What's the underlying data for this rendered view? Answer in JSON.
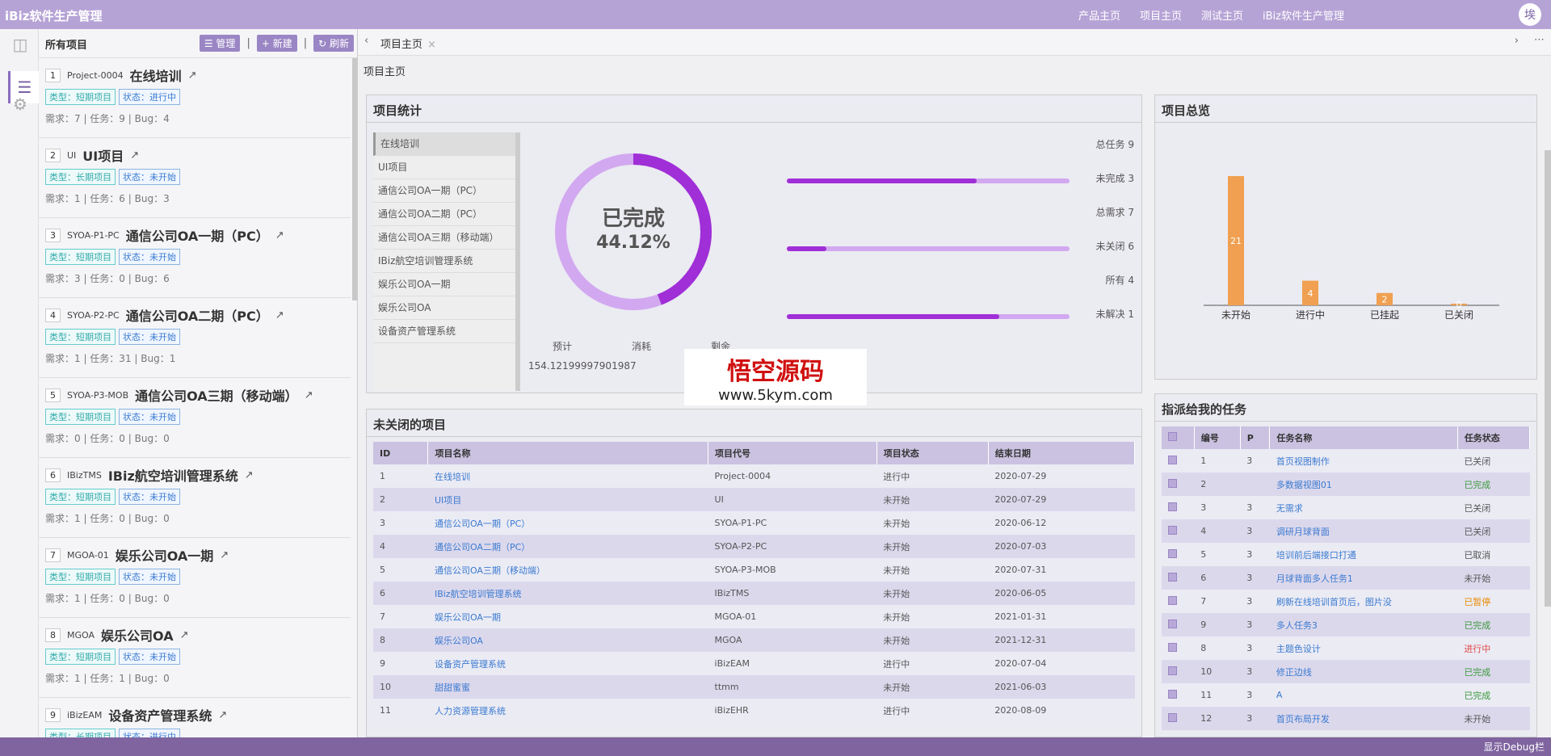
{
  "app": {
    "brand": "iBiz软件生产管理",
    "nav": [
      "产品主页",
      "项目主页",
      "测试主页",
      "iBiz软件生产管理"
    ],
    "avatar": "埃"
  },
  "list": {
    "title": "所有项目",
    "buttons": [
      "管理",
      "新建",
      "刷新"
    ],
    "items": [
      {
        "num": "1",
        "code": "Project-0004",
        "name": "在线培训",
        "type": "类型：短期项目",
        "state": "状态：进行中",
        "stats": "需求：7 | 任务：9 | Bug：4"
      },
      {
        "num": "2",
        "code": "UI",
        "name": "UI项目",
        "type": "类型：长期项目",
        "state": "状态：未开始",
        "stats": "需求：1 | 任务：6 | Bug：3"
      },
      {
        "num": "3",
        "code": "SYOA-P1-PC",
        "name": "通信公司OA一期（PC）",
        "type": "类型：短期项目",
        "state": "状态：未开始",
        "stats": "需求：3 | 任务：0 | Bug：6"
      },
      {
        "num": "4",
        "code": "SYOA-P2-PC",
        "name": "通信公司OA二期（PC）",
        "type": "类型：短期项目",
        "state": "状态：未开始",
        "stats": "需求：1 | 任务：31 | Bug：1"
      },
      {
        "num": "5",
        "code": "SYOA-P3-MOB",
        "name": "通信公司OA三期（移动端）",
        "type": "类型：短期项目",
        "state": "状态：未开始",
        "stats": "需求：0 | 任务：0 | Bug：0"
      },
      {
        "num": "6",
        "code": "IBizTMS",
        "name": "IBiz航空培训管理系统",
        "type": "类型：短期项目",
        "state": "状态：未开始",
        "stats": "需求：1 | 任务：0 | Bug：0"
      },
      {
        "num": "7",
        "code": "MGOA-01",
        "name": "娱乐公司OA一期",
        "type": "类型：短期项目",
        "state": "状态：未开始",
        "stats": "需求：1 | 任务：0 | Bug：0"
      },
      {
        "num": "8",
        "code": "MGOA",
        "name": "娱乐公司OA",
        "type": "类型：短期项目",
        "state": "状态：未开始",
        "stats": "需求：1 | 任务：1 | Bug：0"
      },
      {
        "num": "9",
        "code": "iBizEAM",
        "name": "设备资产管理系统",
        "type": "类型：长期项目",
        "state": "状态：进行中",
        "stats": ""
      }
    ]
  },
  "tab": {
    "label": "项目主页",
    "close": "×"
  },
  "crumb": "项目主页",
  "stat": {
    "title": "项目统计",
    "projects": [
      "在线培训",
      "UI项目",
      "通信公司OA一期（PC）",
      "通信公司OA二期（PC）",
      "通信公司OA三期（移动端）",
      "IBiz航空培训管理系统",
      "娱乐公司OA一期",
      "娱乐公司OA",
      "设备资产管理系统"
    ],
    "done_label": "已完成",
    "done_pct": "44.12%",
    "done_fraction": 0.4412,
    "footer": [
      "预计",
      "消耗",
      "剩余"
    ],
    "footer_value": "154.12199997901987",
    "rows": [
      {
        "label": "总任务",
        "value": "9"
      },
      {
        "label": "未完成",
        "value": "3",
        "fill": 0.67
      },
      {
        "label": "总需求",
        "value": "7"
      },
      {
        "label": "未关闭",
        "value": "6",
        "fill": 0.14
      },
      {
        "label": "所有",
        "value": "4"
      },
      {
        "label": "未解决",
        "value": "1",
        "fill": 0.75
      }
    ]
  },
  "overview": {
    "title": "项目总览"
  },
  "chart_data": {
    "type": "bar",
    "categories": [
      "未开始",
      "进行中",
      "已挂起",
      "已关闭"
    ],
    "values": [
      21,
      4,
      2,
      0
    ],
    "color": "#f0a050"
  },
  "open": {
    "title": "未关闭的项目",
    "headers": [
      "ID",
      "项目名称",
      "项目代号",
      "项目状态",
      "结束日期"
    ],
    "rows": [
      [
        "1",
        "在线培训",
        "Project-0004",
        "进行中",
        "2020-07-29"
      ],
      [
        "2",
        "UI项目",
        "UI",
        "未开始",
        "2020-07-29"
      ],
      [
        "3",
        "通信公司OA一期（PC）",
        "SYOA-P1-PC",
        "未开始",
        "2020-06-12"
      ],
      [
        "4",
        "通信公司OA二期（PC）",
        "SYOA-P2-PC",
        "未开始",
        "2020-07-03"
      ],
      [
        "5",
        "通信公司OA三期（移动端）",
        "SYOA-P3-MOB",
        "未开始",
        "2020-07-31"
      ],
      [
        "6",
        "IBiz航空培训管理系统",
        "IBizTMS",
        "未开始",
        "2020-06-05"
      ],
      [
        "7",
        "娱乐公司OA一期",
        "MGOA-01",
        "未开始",
        "2021-01-31"
      ],
      [
        "8",
        "娱乐公司OA",
        "MGOA",
        "未开始",
        "2021-12-31"
      ],
      [
        "9",
        "设备资产管理系统",
        "iBizEAM",
        "进行中",
        "2020-07-04"
      ],
      [
        "10",
        "甜甜蜜蜜",
        "ttmm",
        "未开始",
        "2021-06-03"
      ],
      [
        "11",
        "人力资源管理系统",
        "iBizEHR",
        "进行中",
        "2020-08-09"
      ]
    ]
  },
  "tasks": {
    "title": "指派给我的任务",
    "headers": [
      "编号",
      "P",
      "任务名称",
      "任务状态"
    ],
    "rows": [
      [
        "1",
        "3",
        "首页视图制作",
        "已关闭"
      ],
      [
        "2",
        "",
        "多数据视图01",
        "已完成"
      ],
      [
        "3",
        "3",
        "无需求",
        "已关闭"
      ],
      [
        "4",
        "3",
        "调研月球背面",
        "已关闭"
      ],
      [
        "5",
        "3",
        "培训前后端接口打通",
        "已取消"
      ],
      [
        "6",
        "3",
        "月球背面多人任务1",
        "未开始"
      ],
      [
        "7",
        "3",
        "刷新在线培训首页后，图片没",
        "已暂停"
      ],
      [
        "9",
        "3",
        "多人任务3",
        "已完成"
      ],
      [
        "8",
        "3",
        "主题色设计",
        "进行中"
      ],
      [
        "10",
        "3",
        "修正边线",
        "已完成"
      ],
      [
        "11",
        "3",
        "A",
        "已完成"
      ],
      [
        "12",
        "3",
        "首页布局开发",
        "未开始"
      ]
    ]
  },
  "watermark": {
    "title": "悟空源码",
    "url": "www.5kym.com"
  },
  "debug": "显示Debug栏"
}
